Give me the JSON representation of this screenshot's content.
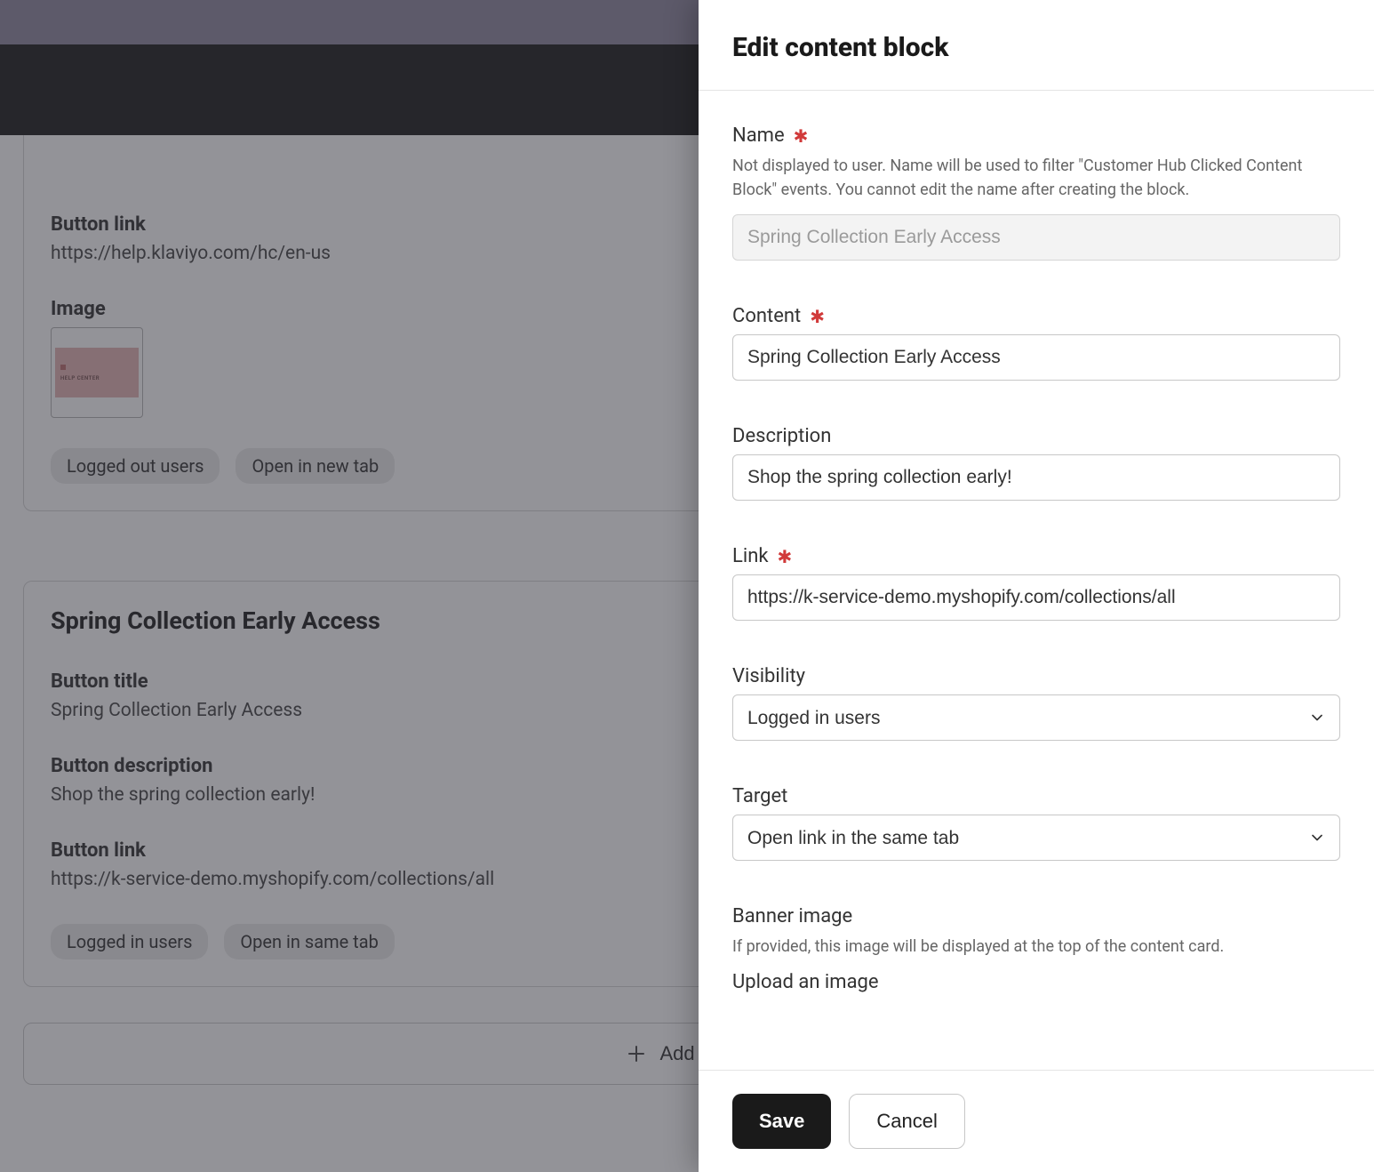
{
  "underlay": {
    "card1": {
      "button_link_label": "Button link",
      "button_link_value": "https://help.klaviyo.com/hc/en-us",
      "image_label": "Image",
      "thumb_caption": "HELP CENTER",
      "chips": [
        "Logged out users",
        "Open in new tab"
      ]
    },
    "card2": {
      "title": "Spring Collection Early Access",
      "button_title_label": "Button title",
      "button_title_value": "Spring Collection Early Access",
      "button_desc_label": "Button description",
      "button_desc_value": "Shop the spring collection early!",
      "button_link_label": "Button link",
      "button_link_value": "https://k-service-demo.myshopify.com/collections/all",
      "chips": [
        "Logged in users",
        "Open in same tab"
      ]
    },
    "add_block_label": "Add Block"
  },
  "panel": {
    "title": "Edit content block",
    "name": {
      "label": "Name",
      "help": "Not displayed to user. Name will be used to filter \"Customer Hub Clicked Content Block\" events. You cannot edit the name after creating the block.",
      "value": "Spring Collection Early Access"
    },
    "content": {
      "label": "Content",
      "value": "Spring Collection Early Access"
    },
    "description": {
      "label": "Description",
      "value": "Shop the spring collection early!"
    },
    "link": {
      "label": "Link",
      "value": "https://k-service-demo.myshopify.com/collections/all"
    },
    "visibility": {
      "label": "Visibility",
      "value": "Logged in users"
    },
    "target": {
      "label": "Target",
      "value": "Open link in the same tab"
    },
    "banner": {
      "label": "Banner image",
      "help": "If provided, this image will be displayed at the top of the content card.",
      "upload_label": "Upload an image"
    },
    "footer": {
      "save": "Save",
      "cancel": "Cancel"
    }
  }
}
